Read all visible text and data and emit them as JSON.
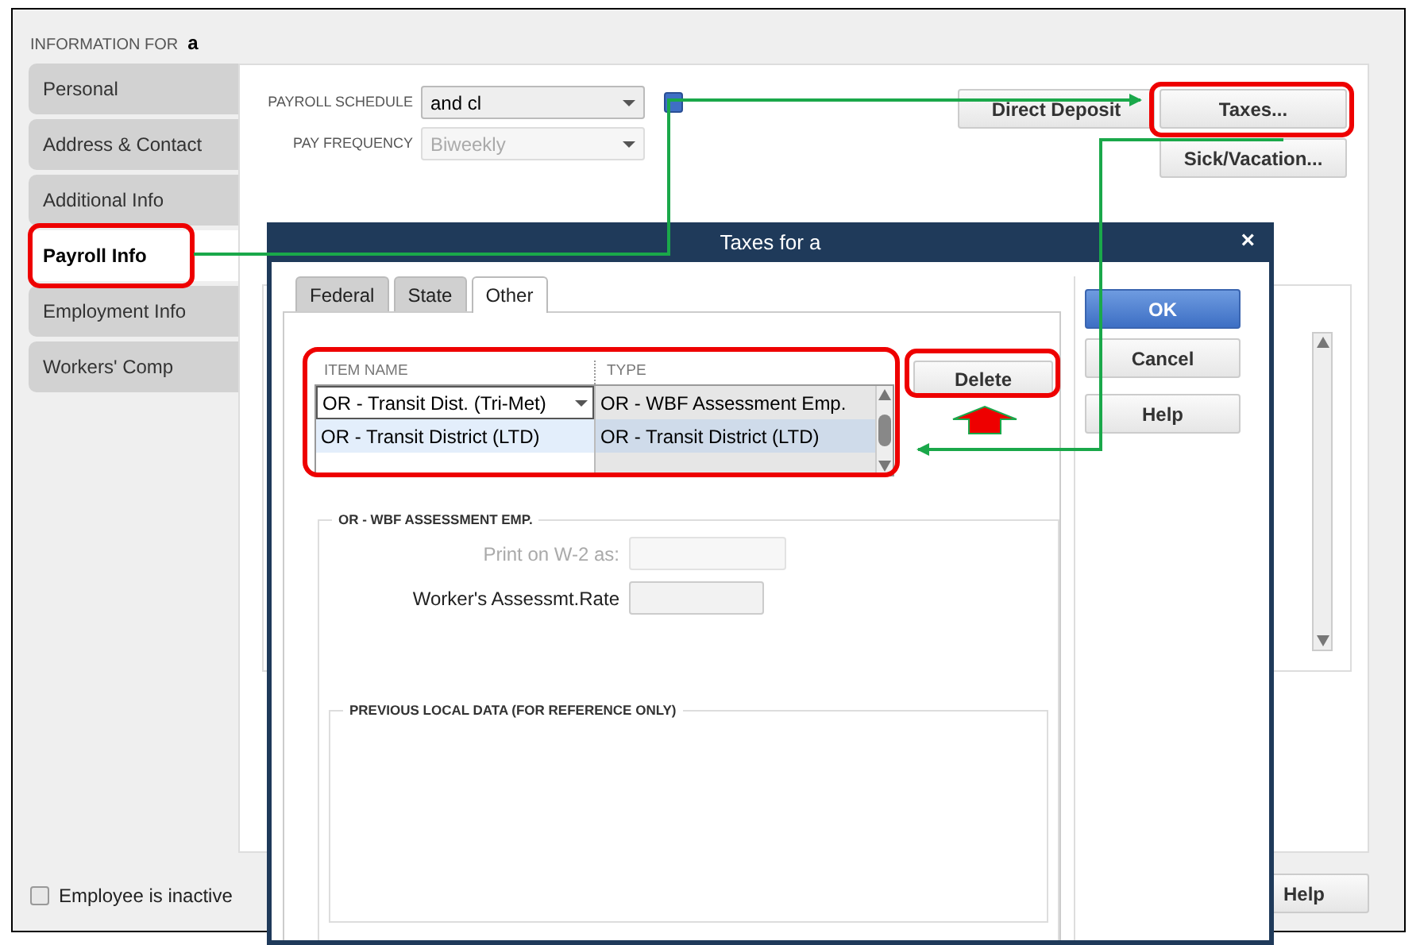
{
  "window": {
    "header_label": "INFORMATION FOR",
    "employee": "a"
  },
  "sidebar": {
    "items": [
      {
        "label": "Personal",
        "selected": false
      },
      {
        "label": "Address & Contact",
        "selected": false
      },
      {
        "label": "Additional Info",
        "selected": false
      },
      {
        "label": "Payroll Info",
        "selected": true
      },
      {
        "label": "Employment Info",
        "selected": false
      },
      {
        "label": "Workers' Comp",
        "selected": false
      }
    ]
  },
  "payroll": {
    "fields": [
      {
        "label": "PAYROLL SCHEDULE",
        "value": "and cl",
        "disabled": false
      },
      {
        "label": "PAY FREQUENCY",
        "value": "Biweekly",
        "disabled": true
      }
    ]
  },
  "buttons": [
    "Direct Deposit",
    "Taxes...",
    "Sick/Vacation..."
  ],
  "inactive": {
    "label": "Employee is inactive",
    "checked": false
  },
  "help_button": "Help",
  "dialog": {
    "title": "Taxes for a",
    "close": "×",
    "tabs": [
      {
        "label": "Federal",
        "selected": false
      },
      {
        "label": "State",
        "selected": false
      },
      {
        "label": "Other",
        "selected": true
      }
    ],
    "columns": [
      "ITEM NAME",
      "TYPE"
    ],
    "rows": [
      {
        "kind": "combo",
        "item": "OR - Transit Dist. (Tri-Met)",
        "type": "OR - WBF Assessment Emp.",
        "selected": false
      },
      {
        "kind": "text",
        "item": "OR - Transit District (LTD)",
        "type": "OR - Transit District (LTD)",
        "selected": true
      }
    ],
    "delete_button": "Delete",
    "group": {
      "title": "OR - WBF ASSESSMENT EMP.",
      "fields": [
        {
          "label": "Print on W-2 as:",
          "disabled": true
        },
        {
          "label": "Worker's Assessmt.Rate",
          "disabled": false
        }
      ]
    },
    "previous": {
      "title": "PREVIOUS LOCAL DATA (FOR REFERENCE ONLY)"
    },
    "side_buttons": [
      {
        "label": "OK",
        "kind": "primary"
      },
      {
        "label": "Cancel",
        "kind": "plain"
      },
      {
        "label": "Help",
        "kind": "plain"
      }
    ]
  }
}
